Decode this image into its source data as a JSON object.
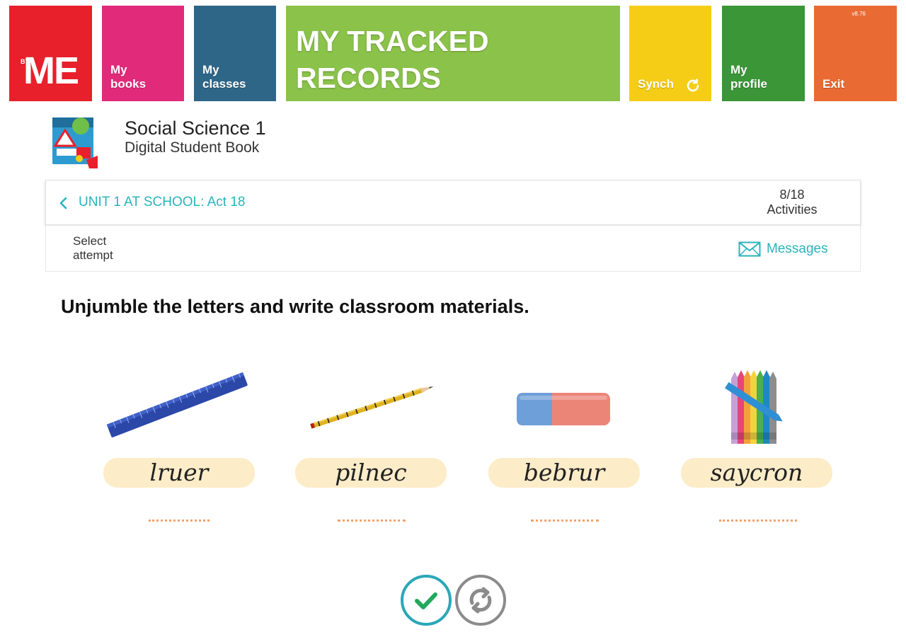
{
  "header": {
    "logo_by": "BY",
    "logo_me": "ME",
    "my_books": "My\nbooks",
    "my_classes": "My\nclasses",
    "title": "MY TRACKED\nRECORDS",
    "synch": "Synch",
    "my_profile": "My\nprofile",
    "exit": "Exit",
    "version": "v8.76"
  },
  "book": {
    "title": "Social Science 1",
    "subtitle": "Digital Student Book"
  },
  "unit": {
    "label": "UNIT 1 AT SCHOOL: Act 18",
    "count": "8/18",
    "count_label": "Activities"
  },
  "attempt": {
    "select_label": "Select\nattempt",
    "messages": "Messages"
  },
  "instruction": "Unjumble the letters and write classroom materials.",
  "items": [
    {
      "image": "ruler",
      "jumbled": "lruer"
    },
    {
      "image": "pencil",
      "jumbled": "pilnec"
    },
    {
      "image": "rubber",
      "jumbled": "bebrur"
    },
    {
      "image": "crayons",
      "jumbled": "saycron"
    }
  ],
  "colors": {
    "logo": "#e8202b",
    "books": "#e22a7b",
    "classes": "#2e6688",
    "title": "#8bc34a",
    "synch": "#f5cd16",
    "profile": "#3a9637",
    "exit": "#ea6a34",
    "accent": "#28b4bd",
    "pill": "#fdecc8"
  },
  "icons": {
    "synch": "refresh-icon",
    "back": "chevron-left-icon",
    "messages": "envelope-icon",
    "check": "check-icon",
    "retry": "retry-icon"
  }
}
